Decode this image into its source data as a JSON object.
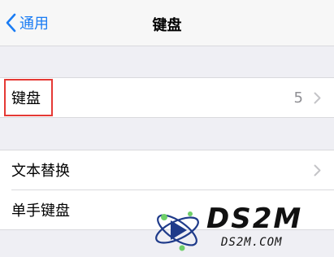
{
  "navbar": {
    "back_label": "通用",
    "title": "键盘"
  },
  "group1": {
    "rows": [
      {
        "label": "键盘",
        "value": "5"
      }
    ]
  },
  "group2": {
    "rows": [
      {
        "label": "文本替换"
      },
      {
        "label": "单手键盘"
      }
    ]
  },
  "watermark": {
    "brand": "DS2M",
    "domain": "DS2M.COM"
  },
  "colors": {
    "accent": "#1a7cf4",
    "highlight_box": "#e53935",
    "background": "#efeff4"
  }
}
